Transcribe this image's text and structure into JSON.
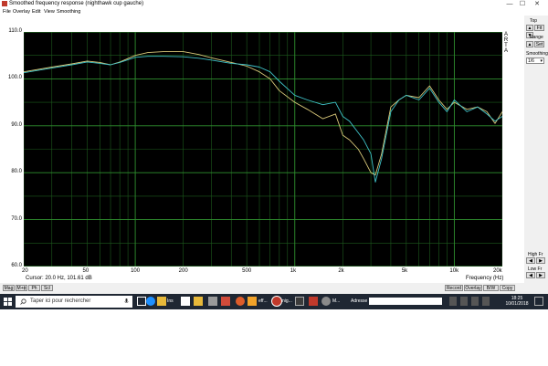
{
  "window": {
    "title": "Smoothed frequency response (nighthawk cup gauche)",
    "controls": {
      "minimize": "—",
      "maximize": "☐",
      "close": "✕"
    }
  },
  "menu": [
    "File",
    "Overlay",
    "Edit",
    "View",
    "Smoothing"
  ],
  "plot": {
    "title": "FR Magnitude dB re 20uPa/V (1/6 oct)",
    "arta_label": [
      "A",
      "R",
      "T",
      "A"
    ],
    "cursor_readout": "Cursor: 20.0 Hz, 101.61 dB",
    "frequency_label": "Frequency (Hz)",
    "y_tick_labels": [
      "110.0",
      "100.0",
      "90.0",
      "80.0",
      "70.0",
      "60.0"
    ],
    "x_tick_labels": [
      "20",
      "50",
      "100",
      "200",
      "500",
      "1k",
      "2k",
      "5k",
      "10k",
      "20k"
    ]
  },
  "sidebar": {
    "top_label": "Top",
    "top_fit": "Fit",
    "range_label": "Range",
    "range_set": "Set",
    "smoothing_label": "Smoothing",
    "smoothing_value": "1/6",
    "high_fr_label": "High Fr",
    "low_fr_label": "Low Fr"
  },
  "bottom_left_buttons": [
    "Mag",
    "M+ϕ",
    "Ph",
    "Scl"
  ],
  "bottom_right_buttons": [
    "Record",
    "Overlay",
    "B/W",
    "Copy"
  ],
  "taskbar": {
    "search_placeholder": "Taper ici pour rechercher",
    "task_labels": [
      "Ins",
      "eff...",
      "nig...",
      "M..."
    ],
    "address_label": "Adresse",
    "time": "18:25",
    "date": "10/01/2018"
  },
  "chart_data": {
    "type": "line",
    "title": "FR Magnitude dB re 20uPa/V (1/6 oct)",
    "xlabel": "Frequency (Hz)",
    "ylabel": "",
    "xscale": "log",
    "xlim": [
      20,
      20000
    ],
    "ylim": [
      60,
      110
    ],
    "grid": true,
    "background": "#000000",
    "series": [
      {
        "color": "#d9c87a",
        "x": [
          20,
          30,
          40,
          50,
          60,
          70,
          80,
          100,
          120,
          150,
          200,
          250,
          300,
          400,
          500,
          600,
          700,
          800,
          1000,
          1200,
          1500,
          1800,
          2000,
          2200,
          2500,
          2700,
          3000,
          3200,
          3500,
          4000,
          4500,
          5000,
          6000,
          7000,
          8000,
          9000,
          10000,
          12000,
          14000,
          16000,
          18000,
          20000
        ],
        "y": [
          101.5,
          102.5,
          103.2,
          103.8,
          103.5,
          103.0,
          103.6,
          105.0,
          105.6,
          105.8,
          105.8,
          105.2,
          104.5,
          103.5,
          102.7,
          101.5,
          100.0,
          97.5,
          95.0,
          93.5,
          91.5,
          92.5,
          88.0,
          87.0,
          85.0,
          83.0,
          80.0,
          79.5,
          84.0,
          94.0,
          95.5,
          96.5,
          96.0,
          98.5,
          95.5,
          93.5,
          95.0,
          93.5,
          94.0,
          93.0,
          90.5,
          93.0
        ]
      },
      {
        "color": "#3fc2c8",
        "x": [
          20,
          30,
          40,
          50,
          60,
          70,
          80,
          100,
          120,
          150,
          200,
          250,
          300,
          400,
          500,
          600,
          700,
          800,
          1000,
          1200,
          1500,
          1800,
          2000,
          2200,
          2500,
          2700,
          3000,
          3200,
          3500,
          4000,
          4500,
          5000,
          6000,
          7000,
          8000,
          9000,
          10000,
          12000,
          14000,
          16000,
          18000,
          20000
        ],
        "y": [
          101.3,
          102.3,
          103.0,
          103.6,
          103.3,
          103.0,
          103.5,
          104.6,
          104.8,
          104.8,
          104.7,
          104.4,
          104.0,
          103.3,
          103.0,
          102.5,
          101.5,
          99.5,
          96.5,
          95.5,
          94.5,
          95.0,
          92.0,
          91.0,
          88.5,
          87.0,
          84.0,
          78.0,
          83.0,
          93.0,
          95.5,
          96.5,
          95.5,
          98.0,
          95.0,
          93.0,
          95.5,
          93.0,
          94.0,
          92.5,
          91.0,
          92.0
        ]
      }
    ]
  }
}
